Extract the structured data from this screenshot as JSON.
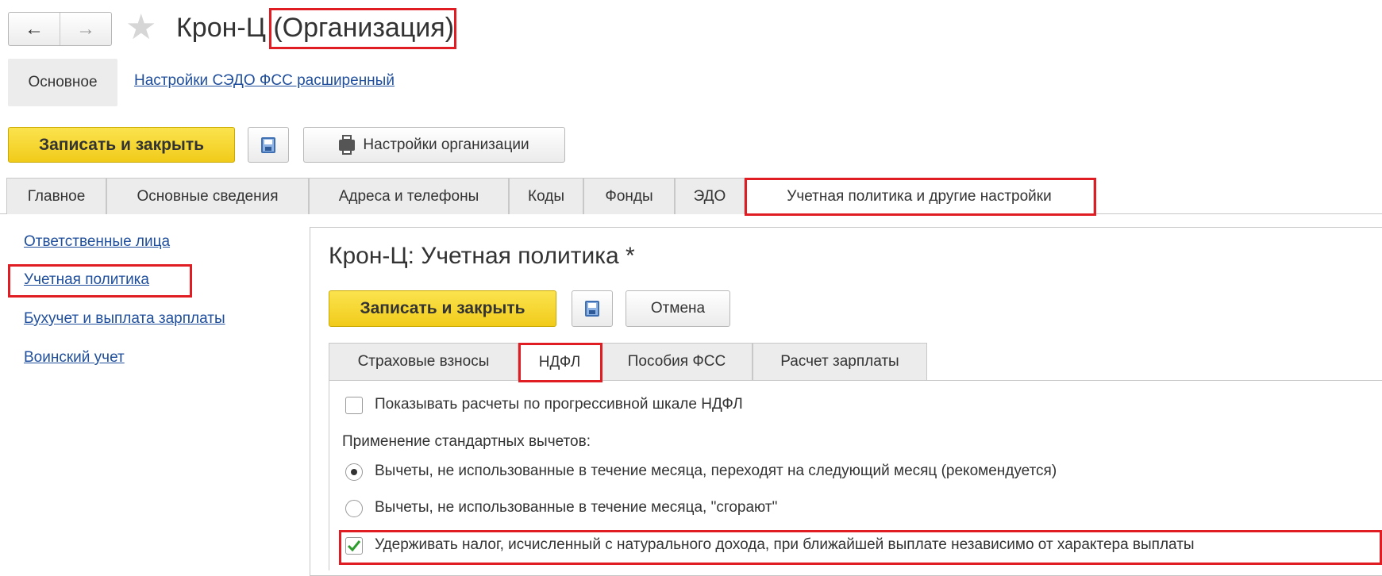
{
  "window": {
    "title_main": "Крон-Ц",
    "title_type": "(Организация)"
  },
  "nav": {
    "back_icon": "arrow-left-icon",
    "forward_icon": "arrow-right-icon",
    "favorite_icon": "star-icon"
  },
  "sections": {
    "main": "Основное",
    "link": "Настройки СЭДО ФСС расширенный"
  },
  "toolbar": {
    "save_close": "Записать и закрыть",
    "org_settings": "Настройки организации"
  },
  "tabs": [
    "Главное",
    "Основные сведения",
    "Адреса и телефоны",
    "Коды",
    "Фонды",
    "ЭДО",
    "Учетная политика и другие настройки"
  ],
  "left_links": [
    "Ответственные лица",
    "Учетная политика",
    "Бухучет и выплата зарплаты",
    "Воинский учет"
  ],
  "policy_form": {
    "title": "Крон-Ц: Учетная политика *",
    "save_close": "Записать и закрыть",
    "cancel": "Отмена",
    "tabs": [
      "Страховые взносы",
      "НДФЛ",
      "Пособия ФСС",
      "Расчет зарплаты"
    ],
    "progressive_scale": {
      "label": "Показывать расчеты по прогрессивной шкале НДФЛ",
      "checked": false
    },
    "deductions_label": "Применение стандартных вычетов:",
    "deductions_options": [
      {
        "label": "Вычеты, не использованные в течение месяца, переходят на следующий месяц (рекомендуется)",
        "selected": true
      },
      {
        "label": "Вычеты, не использованные в течение месяца, \"сгорают\"",
        "selected": false
      }
    ],
    "withhold_in_kind": {
      "label": "Удерживать налог, исчисленный с натурального дохода, при ближайшей выплате независимо от характера выплаты",
      "checked": true
    }
  },
  "colors": {
    "highlight": "#e11d24",
    "link": "#1f4e9c",
    "primary_button": "#f5d327",
    "checkmark": "#2e9d2e"
  }
}
